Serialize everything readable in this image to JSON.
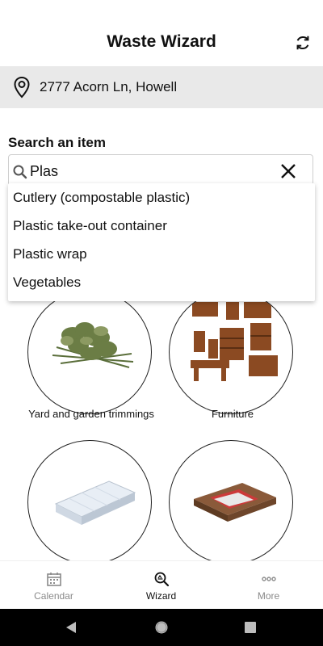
{
  "header": {
    "title": "Waste Wizard",
    "refresh_icon": "refresh-icon"
  },
  "address": {
    "text": "2777 Acorn Ln, Howell",
    "icon": "location-pin-icon"
  },
  "search": {
    "label": "Search an item",
    "value": "Plas",
    "icon": "search-icon",
    "clear_icon": "close-icon"
  },
  "suggestions": [
    "Cutlery (compostable plastic)",
    "Plastic take-out container",
    "Plastic wrap",
    "Vegetables"
  ],
  "categories": [
    {
      "label": "Yard and garden trimmings",
      "icon": "yard-trimmings-image"
    },
    {
      "label": "Furniture",
      "icon": "furniture-image"
    },
    {
      "label": "",
      "icon": "mattress-image"
    },
    {
      "label": "",
      "icon": "wood-pallets-image"
    }
  ],
  "bottom_nav": [
    {
      "label": "Calendar",
      "icon": "calendar-icon",
      "active": false
    },
    {
      "label": "Wizard",
      "icon": "wizard-search-icon",
      "active": true
    },
    {
      "label": "More",
      "icon": "more-dots-icon",
      "active": false
    }
  ],
  "colors": {
    "active_nav": "#111111",
    "inactive_nav": "#8a8a8a",
    "address_bg": "#e9e9e9"
  }
}
